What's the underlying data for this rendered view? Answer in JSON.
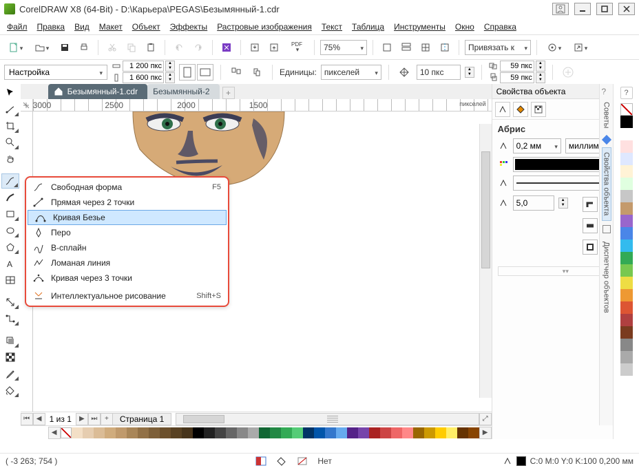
{
  "title": "CorelDRAW X8 (64-Bit) - D:\\Карьера\\PEGAS\\Безымянный-1.cdr",
  "menu": [
    "Файл",
    "Правка",
    "Вид",
    "Макет",
    "Объект",
    "Эффекты",
    "Растровые изображения",
    "Текст",
    "Таблица",
    "Инструменты",
    "Окно",
    "Справка"
  ],
  "toolbar1": {
    "zoom_value": "75%",
    "snap_label": "Привязать к"
  },
  "propbar": {
    "name_field": "Настройка",
    "dim_w": "1 200 пкс",
    "dim_h": "1 600 пкс",
    "units_label": "Единицы:",
    "units_value": "пикселей",
    "nudge": "10 пкс",
    "dup_x": "59 пкс",
    "dup_y": "59 пкс"
  },
  "doctabs": {
    "active": "Безымянный-1.cdr",
    "inactive": "Безымянный-2"
  },
  "ruler": {
    "marks": [
      "3000",
      "2500",
      "2000",
      "1500"
    ],
    "unit": "пикселей"
  },
  "flyout": [
    {
      "label": "Свободная форма",
      "shortcut": "F5"
    },
    {
      "label": "Прямая через 2 точки",
      "shortcut": ""
    },
    {
      "label": "Кривая Безье",
      "shortcut": "",
      "selected": true
    },
    {
      "label": "Перо",
      "shortcut": ""
    },
    {
      "label": "В-сплайн",
      "shortcut": ""
    },
    {
      "label": "Ломаная линия",
      "shortcut": ""
    },
    {
      "label": "Кривая через 3 точки",
      "shortcut": ""
    },
    {
      "label": "Интеллектуальное рисование",
      "shortcut": "Shift+S"
    }
  ],
  "docker": {
    "title": "Свойства объекта",
    "section": "Абрис",
    "width_value": "0,2 мм",
    "units_value": "миллиме...",
    "miter": "5,0"
  },
  "right_tabs": [
    "Советы",
    "Свойства объекта",
    "Диспетчер объектов"
  ],
  "pagenav": {
    "counter": "1 из 1",
    "page_label": "Страница 1"
  },
  "status": {
    "cursor": "( -3 263; 754  )",
    "fill_label": "Нет",
    "outline_info": "C:0 M:0 Y:0 K:100  0,200 мм"
  },
  "right_palette": [
    "#000000",
    "#ffffff",
    "#ffe0e0",
    "#dfe8ff",
    "#fff3d6",
    "#e0ffe0",
    "#c7c7c7",
    "#c49a6c",
    "#9966cc",
    "#4a86e8",
    "#33bbee",
    "#33aa55",
    "#78c850",
    "#eedd44",
    "#ee9933",
    "#dd5533",
    "#b04040",
    "#7a3b1f",
    "#888888",
    "#aaaaaa",
    "#cccccc"
  ],
  "bottom_palette_skin": [
    "#f3dfc6",
    "#e6cdb0",
    "#dbbc96",
    "#d0ac7d",
    "#c09a6c",
    "#a98658",
    "#927146",
    "#7d5f38",
    "#6c502c",
    "#594223",
    "#47341b"
  ],
  "bottom_palette_std": [
    "#000000",
    "#222222",
    "#444444",
    "#666666",
    "#888888",
    "#aaaaaa",
    "#116633",
    "#228844",
    "#33aa55",
    "#55cc77",
    "#003366",
    "#0055aa",
    "#3377cc",
    "#66aaee",
    "#552288",
    "#7744aa",
    "#aa2222",
    "#cc4444",
    "#ee6666",
    "#ff8888",
    "#996600",
    "#cc9900",
    "#ffcc00",
    "#ffee66",
    "#663300",
    "#884400"
  ]
}
